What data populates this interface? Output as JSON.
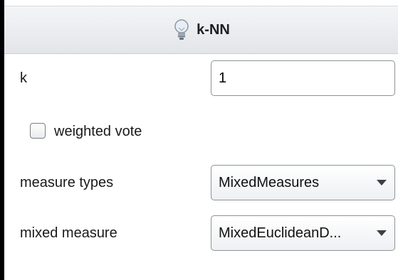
{
  "header": {
    "title": "k-NN",
    "icon": "lightbulb-icon"
  },
  "params": {
    "k": {
      "label": "k",
      "value": "1"
    },
    "weighted_vote": {
      "label": "weighted vote",
      "checked": false
    },
    "measure_types": {
      "label": "measure types",
      "value": "MixedMeasures"
    },
    "mixed_measure": {
      "label": "mixed measure",
      "value": "MixedEuclideanD..."
    }
  }
}
